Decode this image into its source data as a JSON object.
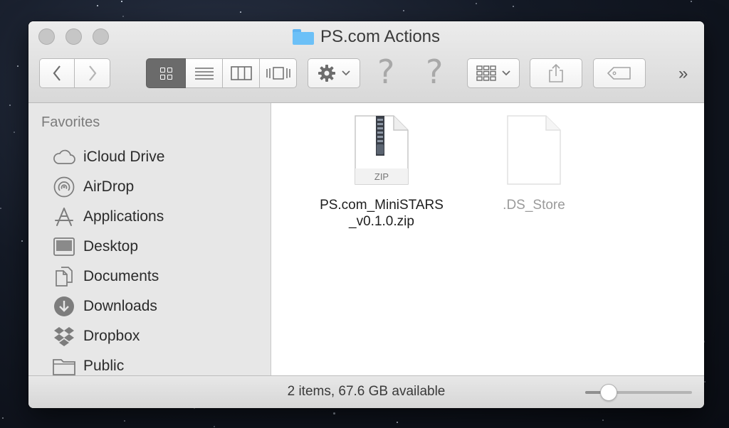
{
  "window": {
    "title": "PS.com Actions"
  },
  "toolbar": {
    "back_icon": "chevron-left-icon",
    "forward_icon": "chevron-right-icon",
    "view_modes": [
      {
        "name": "icon-view",
        "icon": "grid-icon",
        "active": true
      },
      {
        "name": "list-view",
        "icon": "list-icon",
        "active": false
      },
      {
        "name": "column-view",
        "icon": "columns-icon",
        "active": false
      },
      {
        "name": "cover-flow-view",
        "icon": "coverflow-icon",
        "active": false
      }
    ],
    "action_icon": "gear-icon",
    "unknown_item_1": "?",
    "unknown_item_2": "?",
    "arrange_icon": "arrange-icon",
    "share_icon": "share-icon",
    "tag_icon": "tag-icon",
    "overflow": "»"
  },
  "sidebar": {
    "heading": "Favorites",
    "items": [
      {
        "label": "iCloud Drive",
        "icon": "cloud-icon"
      },
      {
        "label": "AirDrop",
        "icon": "airdrop-icon"
      },
      {
        "label": "Applications",
        "icon": "applications-icon"
      },
      {
        "label": "Desktop",
        "icon": "desktop-icon"
      },
      {
        "label": "Documents",
        "icon": "documents-icon"
      },
      {
        "label": "Downloads",
        "icon": "downloads-icon"
      },
      {
        "label": "Dropbox",
        "icon": "dropbox-icon"
      },
      {
        "label": "Public",
        "icon": "folder-icon"
      }
    ]
  },
  "files": [
    {
      "name_line1": "PS.com_MiniSTARS",
      "name_line2": "_v0.1.0.zip",
      "badge": "ZIP",
      "hidden": false
    },
    {
      "name_line1": ".DS_Store",
      "name_line2": "",
      "hidden": true
    }
  ],
  "status": {
    "text": "2 items, 67.6 GB available",
    "zoom_fraction": 0.22
  },
  "colors": {
    "folder_blue": "#6cc0f7",
    "active_segment": "#6b6b6b",
    "hidden_file_text": "#9a9a9a"
  }
}
